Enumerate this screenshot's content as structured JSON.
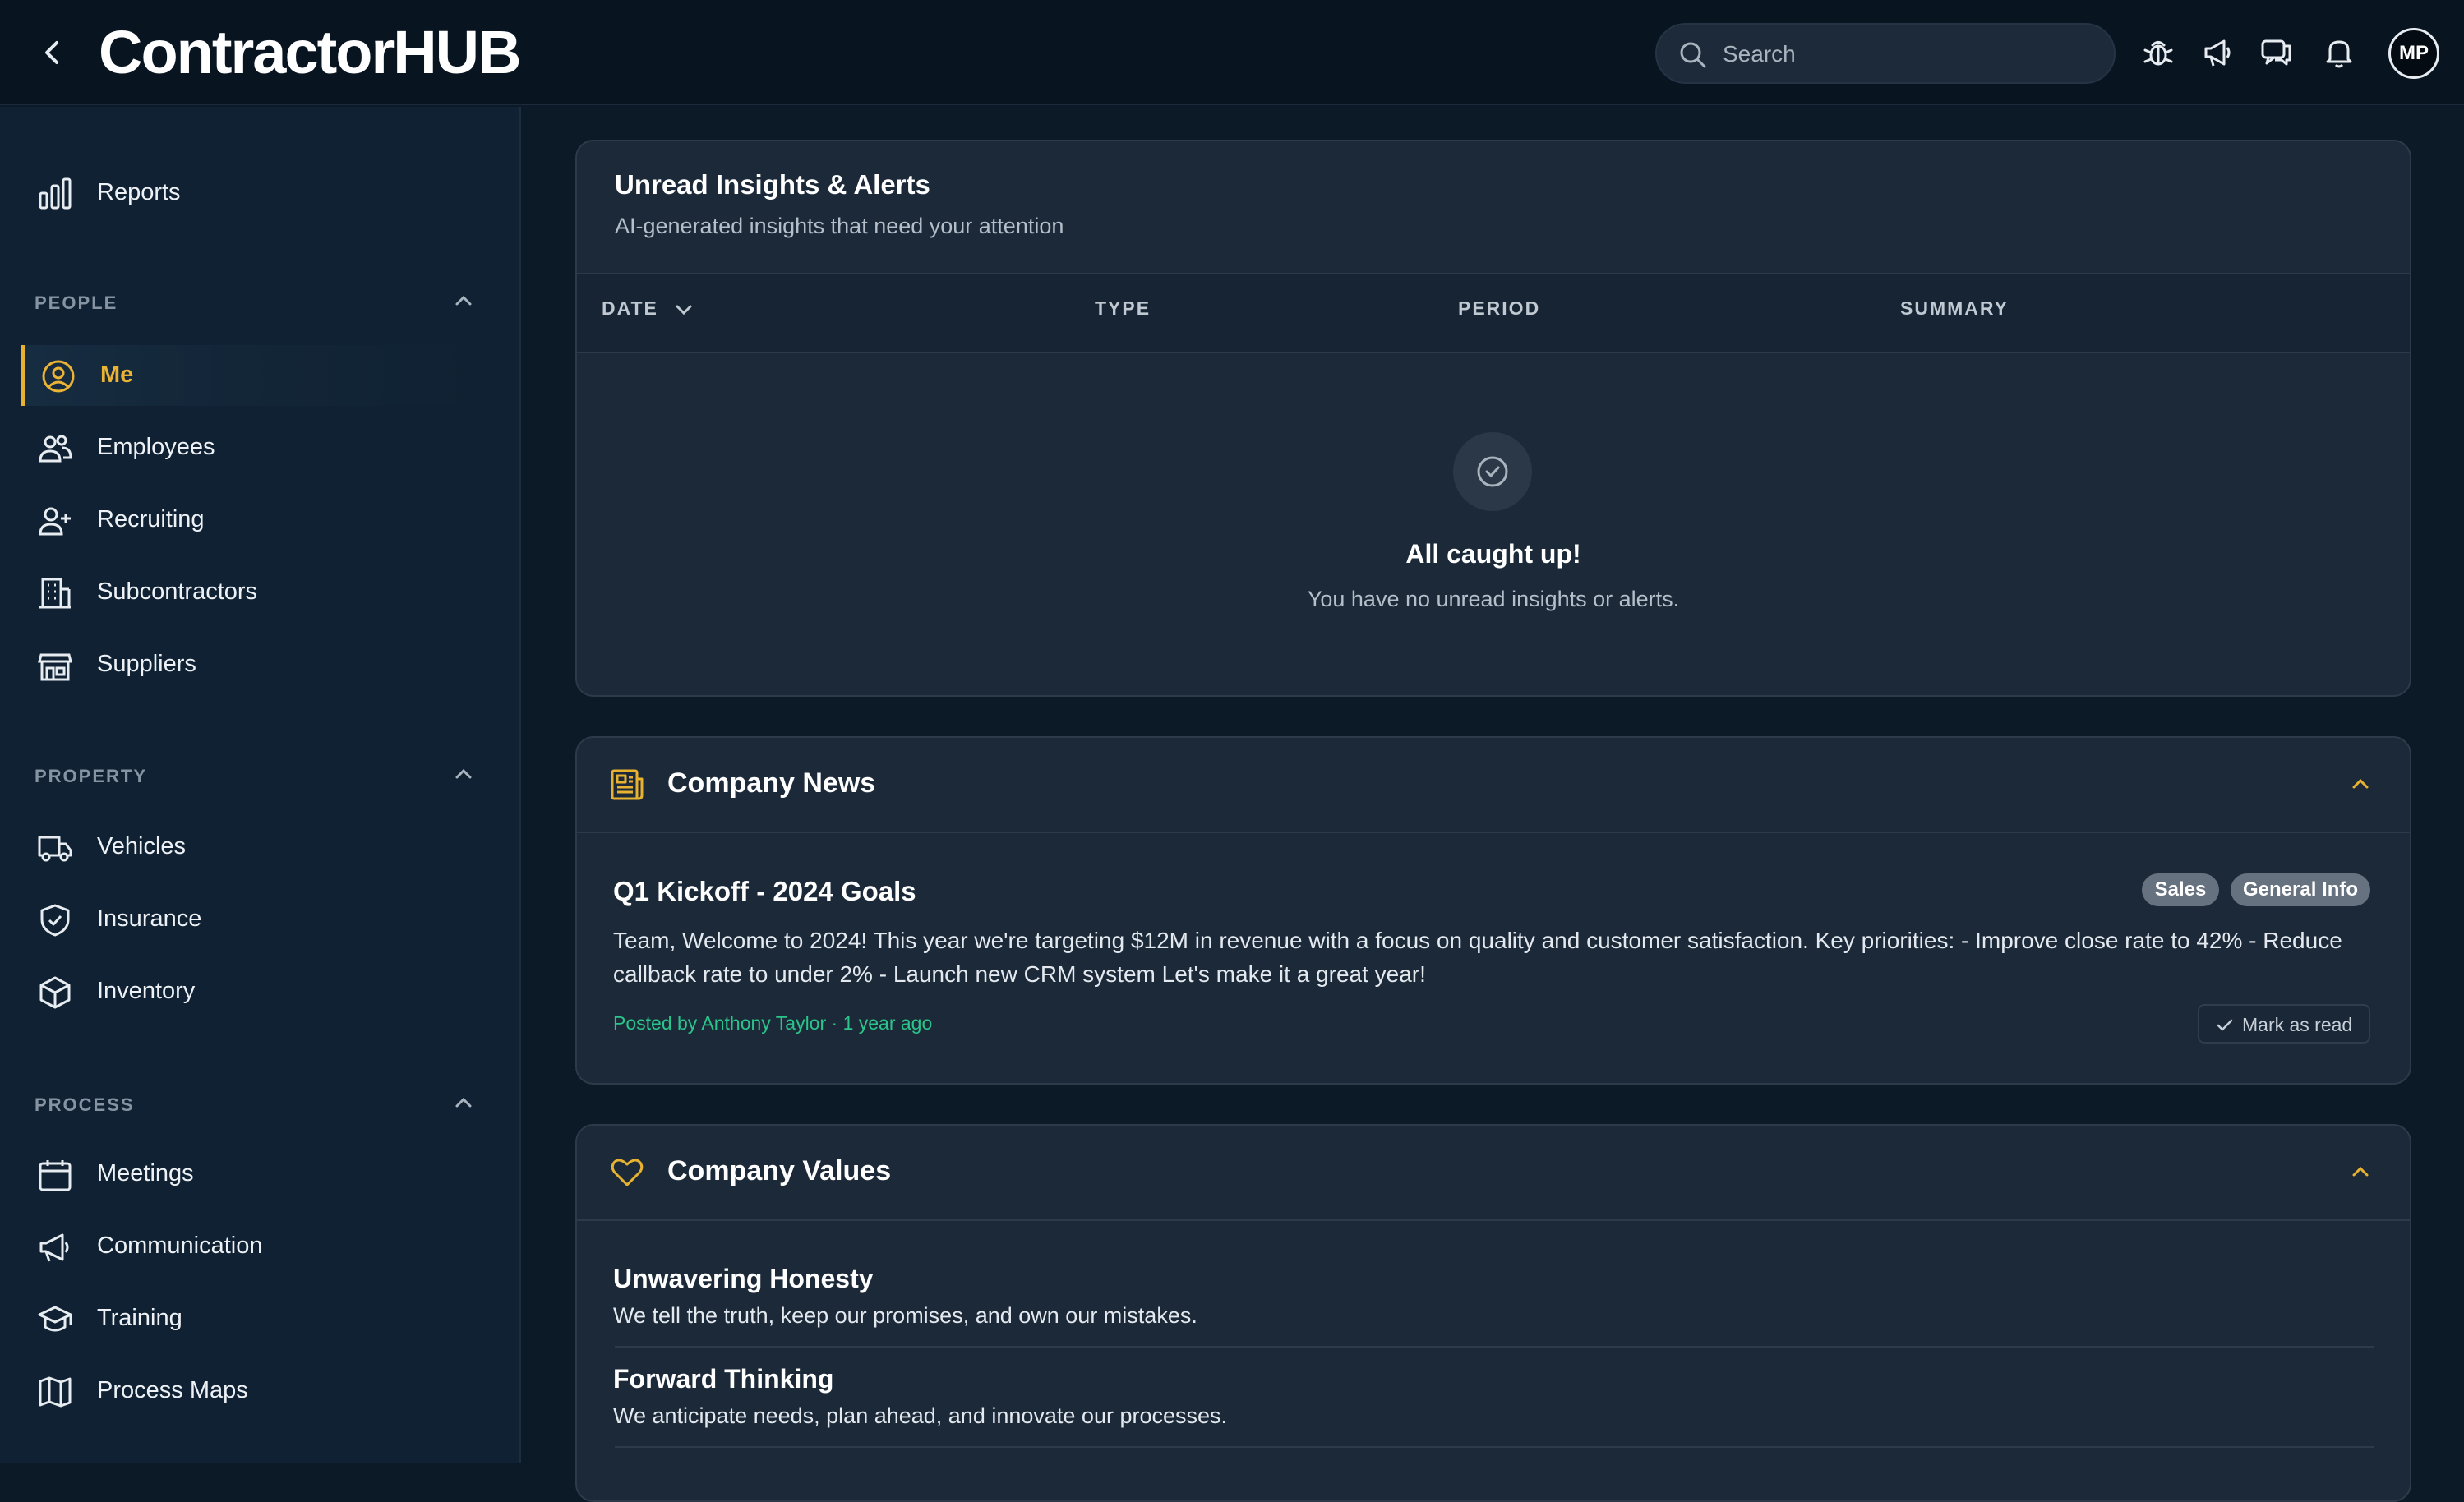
{
  "header": {
    "logo": "ContractorHUB",
    "search_placeholder": "Search",
    "avatar_initials": "MP"
  },
  "sidebar": {
    "reports_label": "Reports",
    "sections": {
      "people": "PEOPLE",
      "property": "PROPERTY",
      "process": "PROCESS"
    },
    "people_items": [
      "Me",
      "Employees",
      "Recruiting",
      "Subcontractors",
      "Suppliers"
    ],
    "property_items": [
      "Vehicles",
      "Insurance",
      "Inventory"
    ],
    "process_items": [
      "Meetings",
      "Communication",
      "Training",
      "Process Maps"
    ]
  },
  "insights": {
    "title": "Unread Insights & Alerts",
    "subtitle": "AI-generated insights that need your attention",
    "columns": [
      "DATE",
      "TYPE",
      "PERIOD",
      "SUMMARY"
    ],
    "empty_title": "All caught up!",
    "empty_text": "You have no unread insights or alerts."
  },
  "news": {
    "title": "Company News",
    "post_title": "Q1 Kickoff - 2024 Goals",
    "tags": [
      "Sales",
      "General Info"
    ],
    "body": "Team, Welcome to 2024! This year we're targeting $12M in revenue with a focus on quality and customer satisfaction. Key priorities: - Improve close rate to 42% - Reduce callback rate to under 2% - Launch new CRM system Let's make it a great year!",
    "posted_by": "Posted by Anthony Taylor · 1 year ago",
    "mark_read_label": "Mark as read"
  },
  "values": {
    "title": "Company Values",
    "items": [
      {
        "name": "Unwavering Honesty",
        "desc": "We tell the truth, keep our promises, and own our mistakes."
      },
      {
        "name": "Forward Thinking",
        "desc": "We anticipate needs, plan ahead, and innovate our processes."
      }
    ]
  },
  "colors": {
    "accent": "#e8b231",
    "posted_by": "#2bc48a",
    "background": "#0c1a28",
    "card": "#1b2938"
  }
}
